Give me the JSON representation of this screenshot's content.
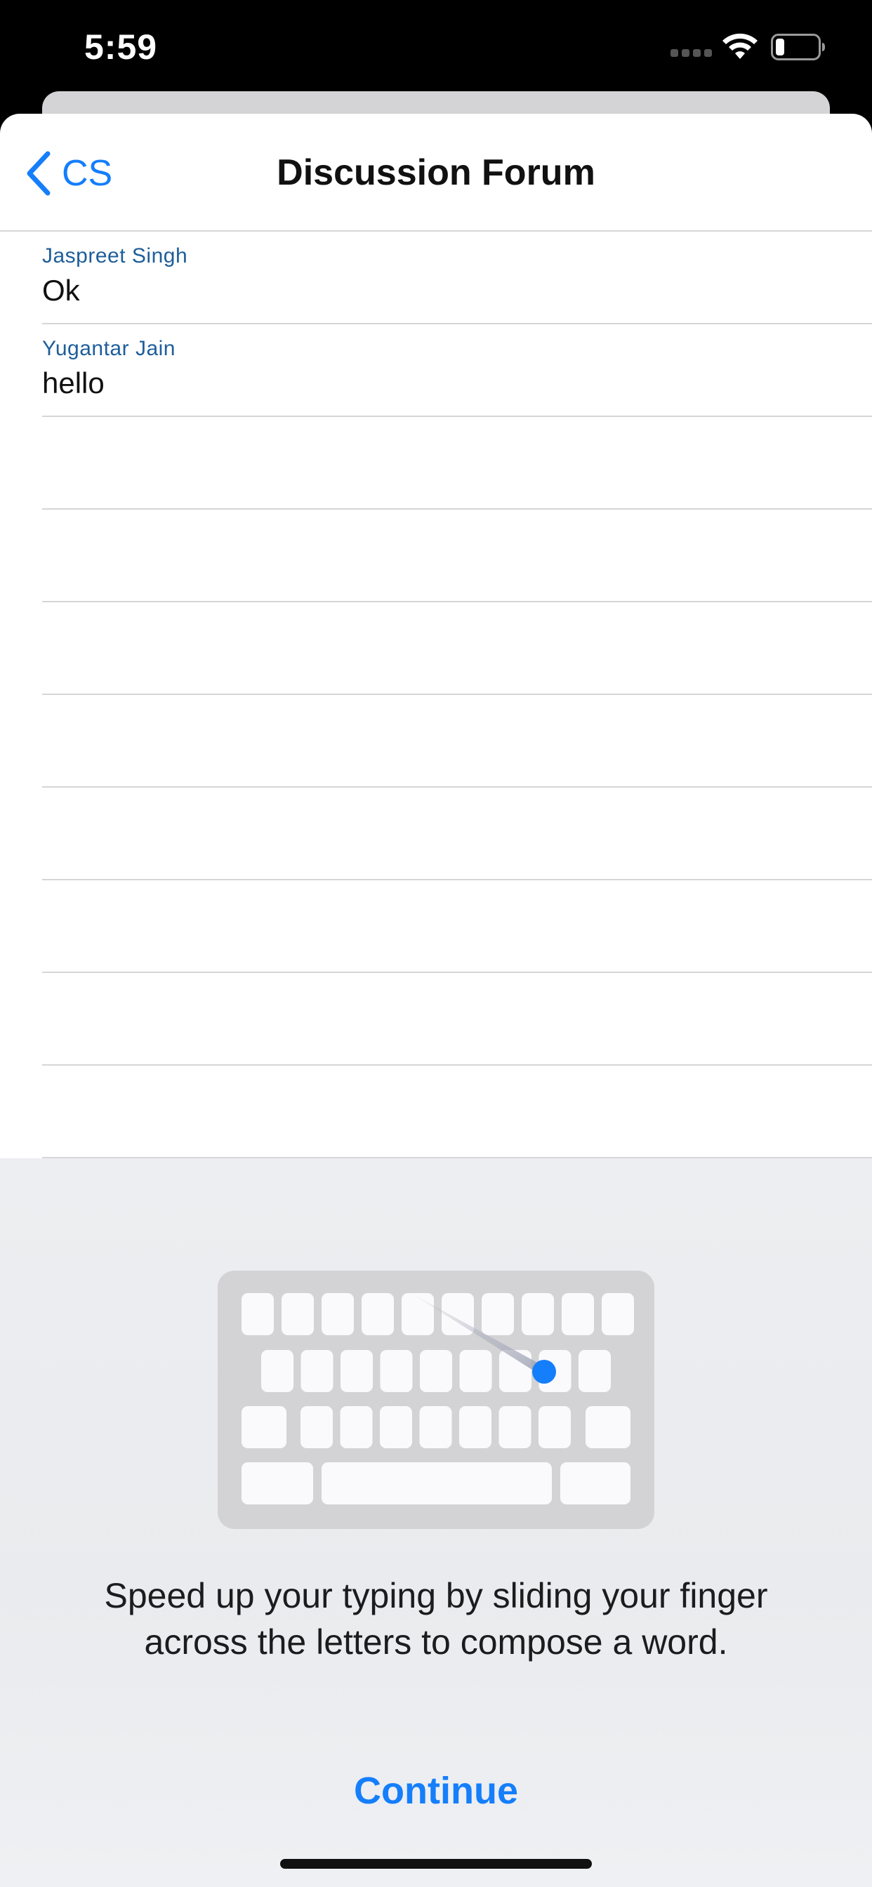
{
  "status_bar": {
    "time": "5:59",
    "icons": [
      "cellular-dots-icon",
      "wifi-icon",
      "battery-icon"
    ]
  },
  "nav": {
    "back_label": "CS",
    "back_icon": "chevron-left-icon",
    "title": "Discussion Forum"
  },
  "messages": [
    {
      "author": "Jaspreet Singh",
      "text": "Ok"
    },
    {
      "author": "Yugantar Jain",
      "text": "hello"
    }
  ],
  "onboarding": {
    "illustration": "swipe-keyboard-illustration",
    "description": "Speed up your typing by sliding your finger across the letters to compose a word.",
    "continue_label": "Continue"
  },
  "colors": {
    "accent": "#157efb",
    "author": "#1e5e9a",
    "separator": "#d6d6d8",
    "panel_background": "#eceef1"
  }
}
